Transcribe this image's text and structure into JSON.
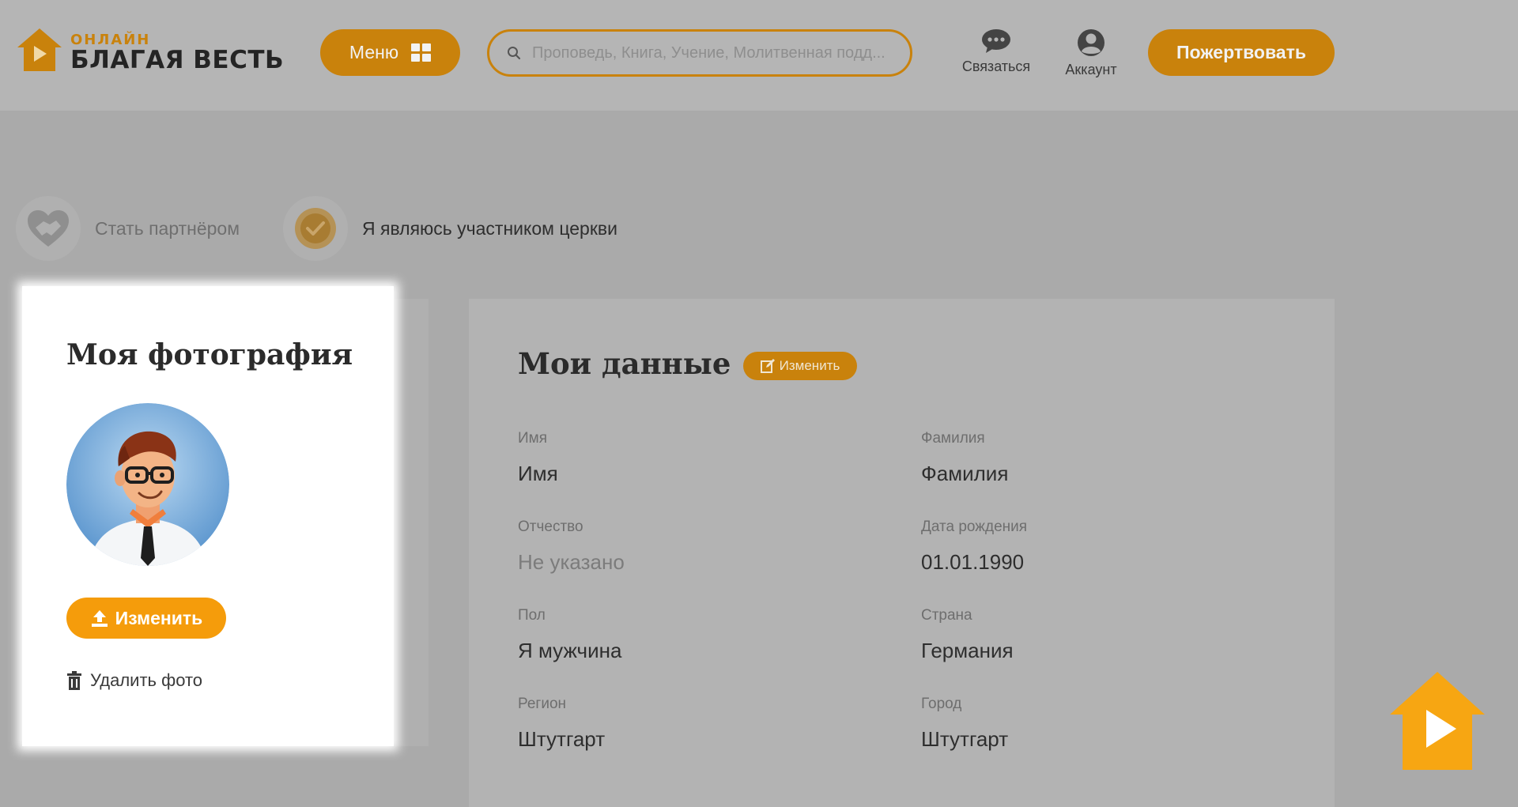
{
  "header": {
    "logo_small": "ОНЛАЙН",
    "logo_big": "БЛАГАЯ ВЕСТЬ",
    "menu_label": "Меню",
    "search_placeholder": "Проповедь, Книга, Учение, Молитвенная подд...",
    "contact_label": "Связаться",
    "account_label": "Аккаунт",
    "donate_label": "Пожертвовать"
  },
  "status": {
    "partner_label": "Стать партнёром",
    "member_label": "Я являюсь участником церкви"
  },
  "photo": {
    "title": "Моя фотография",
    "change_label": "Изменить",
    "delete_label": "Удалить фото"
  },
  "profile": {
    "title": "Мои данные",
    "edit_label": "Изменить",
    "fields": {
      "first_name": {
        "label": "Имя",
        "value": "Имя"
      },
      "last_name": {
        "label": "Фамилия",
        "value": "Фамилия"
      },
      "patronymic": {
        "label": "Отчество",
        "value": "Не указано"
      },
      "birth_date": {
        "label": "Дата рождения",
        "value": "01.01.1990"
      },
      "gender": {
        "label": "Пол",
        "value": "Я мужчина"
      },
      "country": {
        "label": "Страна",
        "value": "Германия"
      },
      "region": {
        "label": "Регион",
        "value": "Штутгарт"
      },
      "city": {
        "label": "Город",
        "value": "Штутгарт"
      }
    }
  },
  "colors": {
    "accent": "#f59c0b",
    "accent_dimmed": "#c9820c",
    "overlay_bg": "#aaaaaa",
    "card_bg": "#ffffff"
  },
  "icons": {
    "logo": "house-play-icon",
    "menu": "grid-icon",
    "search": "search-icon",
    "contact": "chat-bubble-icon",
    "account": "user-circle-icon",
    "partner": "handshake-heart-icon",
    "member": "badge-check-icon",
    "upload": "upload-icon",
    "delete": "trash-icon",
    "edit": "edit-icon",
    "float": "house-play-icon"
  }
}
